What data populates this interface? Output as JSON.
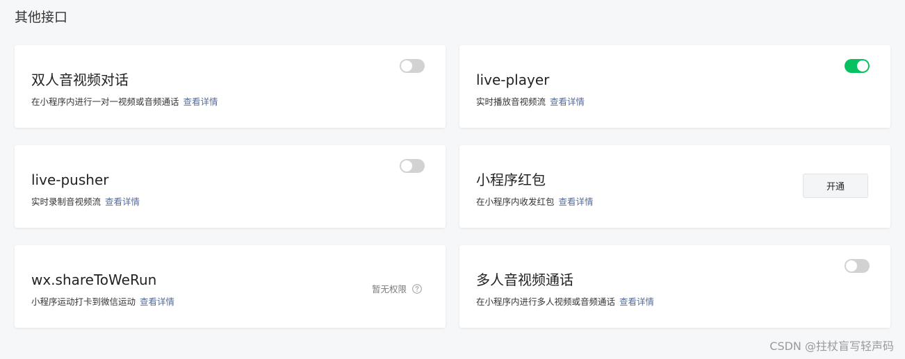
{
  "section": {
    "title": "其他接口"
  },
  "cards": [
    {
      "title": "双人音视频对话",
      "description": "在小程序内进行一对一视频或音频通话",
      "detail_link": "查看详情",
      "control": "toggle",
      "enabled": false
    },
    {
      "title": "live-player",
      "description": "实时播放音视频流",
      "detail_link": "查看详情",
      "control": "toggle",
      "enabled": true
    },
    {
      "title": "live-pusher",
      "description": "实时录制音视频流",
      "detail_link": "查看详情",
      "control": "toggle",
      "enabled": false
    },
    {
      "title": "小程序红包",
      "description": "在小程序内收发红包",
      "detail_link": "查看详情",
      "control": "button",
      "button_label": "开通"
    },
    {
      "title": "wx.shareToWeRun",
      "description": "小程序运动打卡到微信运动",
      "detail_link": "查看详情",
      "control": "status",
      "status_text": "暂无权限",
      "status_icon": "question-circle-icon"
    },
    {
      "title": "多人音视频通话",
      "description": "在小程序内进行多人视频或音频通话",
      "detail_link": "查看详情",
      "control": "toggle",
      "enabled": false
    }
  ],
  "watermark": "CSDN @拄杖盲写轻声码",
  "colors": {
    "toggle_on": "#07c160",
    "toggle_off": "#d2d2d2",
    "link": "#576b95",
    "background": "#f6f7f9"
  }
}
